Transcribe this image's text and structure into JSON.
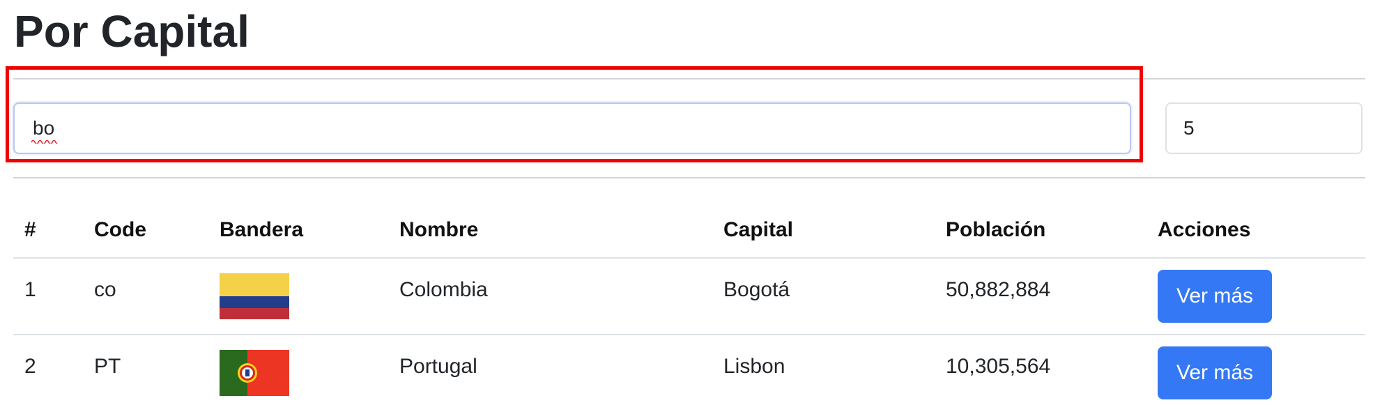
{
  "page": {
    "title": "Por Capital"
  },
  "search": {
    "value": "bo",
    "limit_value": "5"
  },
  "table": {
    "columns": [
      "#",
      "Code",
      "Bandera",
      "Nombre",
      "Capital",
      "Población",
      "Acciones"
    ],
    "rows": [
      {
        "index": "1",
        "code": "co",
        "flag": "colombia-flag-icon",
        "name": "Colombia",
        "capital": "Bogotá",
        "population": "50,882,884",
        "action_label": "Ver más"
      },
      {
        "index": "2",
        "code": "PT",
        "flag": "portugal-flag-icon",
        "name": "Portugal",
        "capital": "Lisbon",
        "population": "10,305,564",
        "action_label": "Ver más"
      }
    ]
  },
  "colors": {
    "accent_button": "#3478f6",
    "highlight_border": "#f00000",
    "colombia_yellow": "#f5d14a",
    "colombia_blue": "#223e8b",
    "colombia_red": "#bf2f3a",
    "portugal_green": "#2a6a1f",
    "portugal_red": "#ec3523"
  }
}
